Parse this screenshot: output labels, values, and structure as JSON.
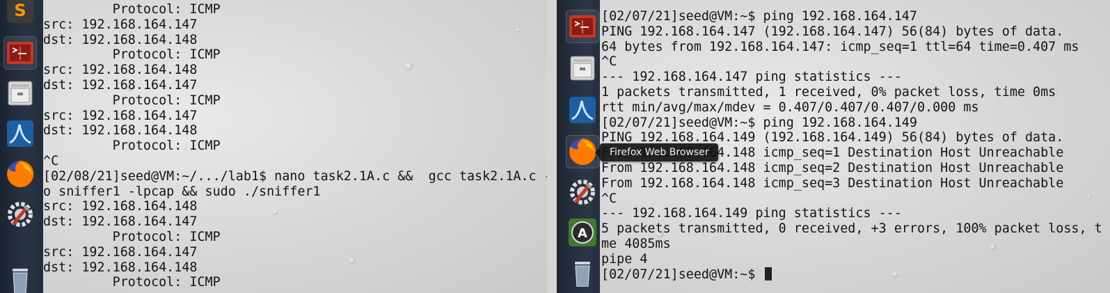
{
  "left_terminal": {
    "lines": [
      "         Protocol: ICMP",
      "src: 192.168.164.147",
      "dst: 192.168.164.148",
      "         Protocol: ICMP",
      "src: 192.168.164.148",
      "dst: 192.168.164.147",
      "         Protocol: ICMP",
      "src: 192.168.164.147",
      "dst: 192.168.164.148",
      "         Protocol: ICMP",
      "^C",
      "[02/08/21]seed@VM:~/.../lab1$ nano task2.1A.c &&  gcc task2.1A.c -",
      "o sniffer1 -lpcap && sudo ./sniffer1",
      "src: 192.168.164.148",
      "dst: 192.168.164.147",
      "         Protocol: ICMP",
      "src: 192.168.164.147",
      "dst: 192.168.164.148",
      "         Protocol: ICMP"
    ]
  },
  "right_terminal": {
    "lines": [
      "[02/07/21]seed@VM:~$ ping 192.168.164.147",
      "PING 192.168.164.147 (192.168.164.147) 56(84) bytes of data.",
      "64 bytes from 192.168.164.147: icmp_seq=1 ttl=64 time=0.407 ms",
      "^C",
      "--- 192.168.164.147 ping statistics ---",
      "1 packets transmitted, 1 received, 0% packet loss, time 0ms",
      "rtt min/avg/max/mdev = 0.407/0.407/0.407/0.000 ms",
      "[02/07/21]seed@VM:~$ ping 192.168.164.149",
      "PING 192.168.164.149 (192.168.164.149) 56(84) bytes of data.",
      "From 192.168.164.148 icmp_seq=1 Destination Host Unreachable",
      "From 192.168.164.148 icmp_seq=2 Destination Host Unreachable",
      "From 192.168.164.148 icmp_seq=3 Destination Host Unreachable",
      "^C",
      "--- 192.168.164.149 ping statistics ---",
      "5 packets transmitted, 0 received, +3 errors, 100% packet loss, t",
      "me 4085ms",
      "pipe 4"
    ],
    "prompt": "[02/07/21]seed@VM:~$ "
  },
  "tooltip": {
    "text": "Firefox Web Browser"
  },
  "launcher": {
    "icons": [
      "sublime-text-icon",
      "terminal-icon",
      "file-manager-icon",
      "wireshark-icon",
      "firefox-icon",
      "settings-icon",
      "update-icon",
      "trash-icon"
    ]
  }
}
